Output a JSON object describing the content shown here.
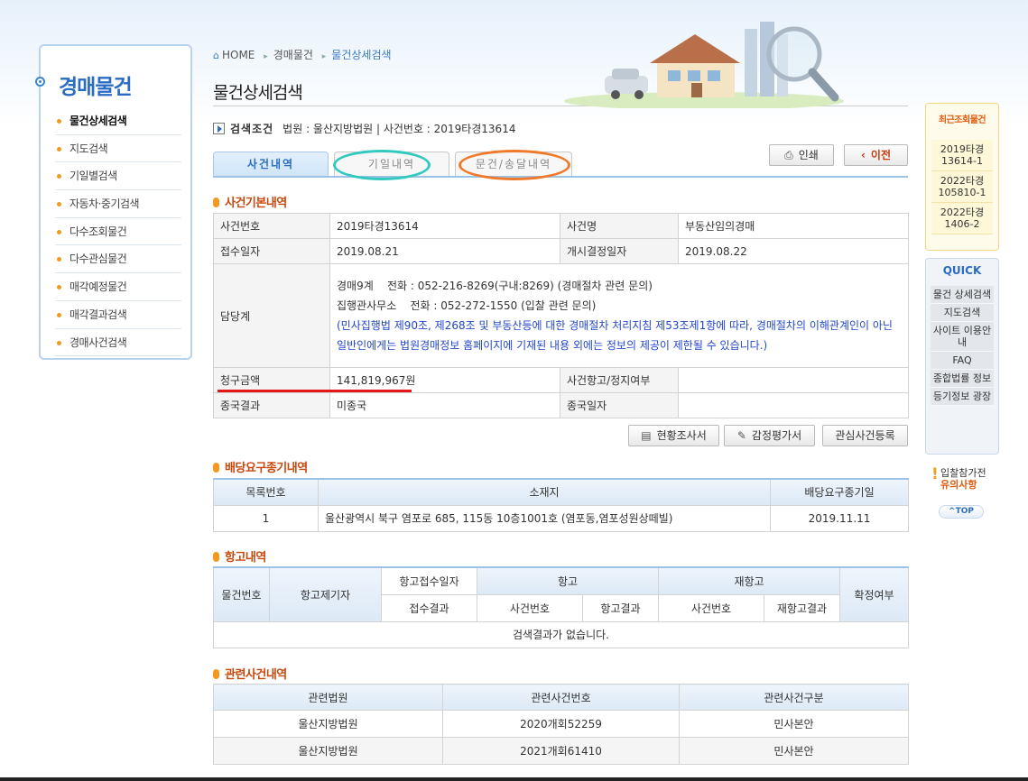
{
  "leftnav": {
    "title": "경매물건",
    "items": [
      {
        "label": "물건상세검색"
      },
      {
        "label": "지도검색"
      },
      {
        "label": "기일별검색"
      },
      {
        "label": "자동차·중기검색"
      },
      {
        "label": "다수조회물건"
      },
      {
        "label": "다수관심물건"
      },
      {
        "label": "매각예정물건"
      },
      {
        "label": "매각결과검색"
      },
      {
        "label": "경매사건검색"
      }
    ]
  },
  "breadcrumb": [
    "HOME",
    "경매물건",
    "물건상세검색"
  ],
  "page_title": "물건상세검색",
  "search_condition": {
    "label": "검색조건",
    "text": "법원 : 울산지방법원 | 사건번호 : 2019타경13614"
  },
  "tabs": [
    "사건내역",
    "기일내역",
    "문건/송달내역"
  ],
  "buttons": {
    "print": "인쇄",
    "back": "이전",
    "survey": "현황조사서",
    "appraisal": "감정평가서",
    "interest": "관심사건등록"
  },
  "basic": {
    "heading": "사건기본내역",
    "case_no_label": "사건번호",
    "case_no": "2019타경13614",
    "case_name_label": "사건명",
    "case_name": "부동산임의경매",
    "receipt_label": "접수일자",
    "receipt": "2019.08.21",
    "start_label": "개시결정일자",
    "start": "2019.08.22",
    "charge_label": "담당계",
    "charge_line1": "경매9계    전화 : 052-216-8269(구내:8269) (경매절차 관련 문의)",
    "charge_line2": "집행관사무소    전화 : 052-272-1550 (입찰 관련 문의)",
    "charge_note": "(민사집행법 제90조, 제268조 및 부동산등에 대한 경매절차 처리지침 제53조제1항에 따라, 경매절차의 이해관계인이 아닌 일반인에게는 법원경매정보 홈페이지에 기재된 내용 외에는 정보의 제공이 제한될 수 있습니다.)",
    "claim_label": "청구금액",
    "claim": "141,819,967원",
    "appeal_label": "사건항고/정지여부",
    "appeal": "",
    "final_label": "종국결과",
    "final": "미종국",
    "final_date_label": "종국일자",
    "final_date": ""
  },
  "dividend": {
    "heading": "배당요구종기내역",
    "headers": [
      "목록번호",
      "소재지",
      "배당요구종기일"
    ],
    "rows": [
      [
        "1",
        "울산광역시 북구 염포로 685, 115동 10층1001호 (염포동,염포성원상떼빌)",
        "2019.11.11"
      ]
    ]
  },
  "appeal": {
    "heading": "항고내역",
    "h_item": "물건번호",
    "h_filer": "항고제기자",
    "h_date": "항고접수일자",
    "h_result": "접수결과",
    "h_appeal": "항고",
    "h_reappeal": "재항고",
    "h_case": "사건번호",
    "h_appeal_result": "항고결과",
    "h_reappeal_case": "사건번호",
    "h_reappeal_result": "재항고결과",
    "h_confirm": "확정여부",
    "empty": "검색결과가 없습니다."
  },
  "related": {
    "heading": "관련사건내역",
    "headers": [
      "관련법원",
      "관련사건번호",
      "관련사건구분"
    ],
    "rows": [
      [
        "울산지방법원",
        "2020개회52259",
        "민사본안"
      ],
      [
        "울산지방법원",
        "2021개회61410",
        "민사본안"
      ]
    ]
  },
  "recent": {
    "title": "최근조회물건",
    "items": [
      "2019타경 13614-1",
      "2022타경 105810-1",
      "2022타경 1406-2"
    ]
  },
  "quick": {
    "title": "QUICK",
    "items": [
      "물건 상세검색",
      "지도검색",
      "사이트 이용안내",
      "FAQ",
      "종합법률 정보",
      "등기정보 광장"
    ]
  },
  "notice": {
    "line1": "입찰참가전",
    "line2": "유의사항"
  },
  "top": "^TOP",
  "colors": {
    "accent": "#2a6cc4",
    "orange": "#c8480c",
    "red": "#e5161a",
    "teal": "#32c9c0",
    "ring_orange": "#f07a2b"
  }
}
